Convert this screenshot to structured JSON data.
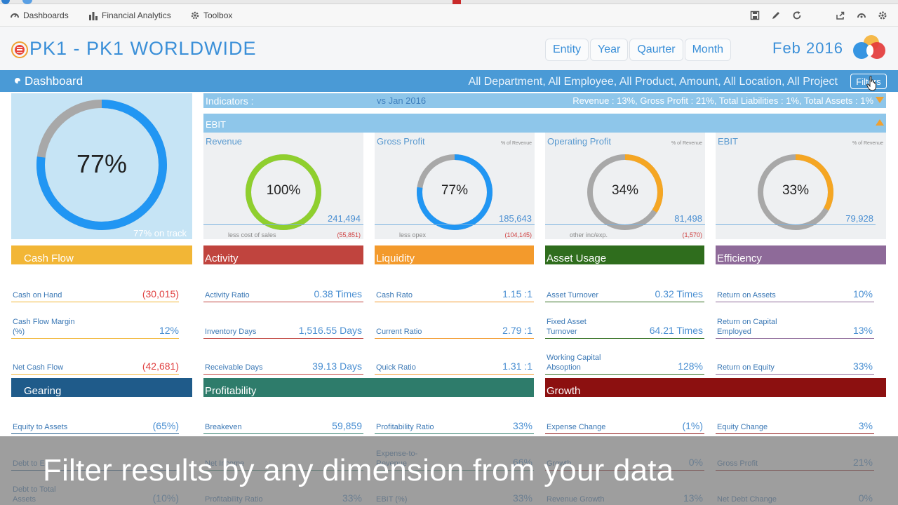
{
  "menu": {
    "dashboards": "Dashboards",
    "financial_analytics": "Financial Analytics",
    "toolbox": "Toolbox"
  },
  "header": {
    "title": "PK1 - PK1 WORLDWIDE",
    "period_buttons": [
      "Entity",
      "Year",
      "Qaurter",
      "Month"
    ],
    "current_period": "Feb 2016"
  },
  "dashboard_bar": {
    "title": "Dashboard",
    "filter_summary": "All Department, All Employee, All Product, Amount, All Location, All Project",
    "filters_label": "Filters"
  },
  "main_gauge": {
    "value": "77%",
    "fraction": 0.77,
    "caption": "77% on track"
  },
  "indicators": {
    "label": "Indicators :",
    "comparison": "vs Jan 2016",
    "summary": "Revenue : 13%, Gross Profit : 21%, Total Liabilities : 1%, Total Assets : 1%",
    "ebit_label": "EBIT"
  },
  "kpis": [
    {
      "title": "Revenue",
      "subtitle": "",
      "pct": "100%",
      "fraction": 1.0,
      "amount": "241,494",
      "note": "less cost of sales",
      "note_value": "(55,851)",
      "color": "#8fcf2e"
    },
    {
      "title": "Gross Profit",
      "subtitle": "% of Revenue",
      "pct": "77%",
      "fraction": 0.77,
      "amount": "185,643",
      "note": "less opex",
      "note_value": "(104,145)",
      "color": "#2196f3"
    },
    {
      "title": "Operating Profit",
      "subtitle": "% of Revenue",
      "pct": "34%",
      "fraction": 0.34,
      "amount": "81,498",
      "note": "other inc/exp.",
      "note_value": "(1,570)",
      "color": "#f5a623"
    },
    {
      "title": "EBIT",
      "subtitle": "% of Revenue",
      "pct": "33%",
      "fraction": 0.33,
      "amount": "79,928",
      "note": "",
      "note_value": "",
      "color": "#f5a623"
    }
  ],
  "sections": {
    "cash_flow": "Cash Flow",
    "activity": "Activity",
    "liquidity": "Liquidity",
    "asset_usage": "Asset Usage",
    "efficiency": "Efficiency",
    "gearing": "Gearing",
    "profitability": "Profitability",
    "growth": "Growth"
  },
  "colors": {
    "cash_flow": "#f2b636",
    "activity": "#c0443e",
    "liquidity": "#f39a2c",
    "asset_usage": "#2f6d1d",
    "efficiency": "#8e6a99",
    "gearing": "#1f5b8a",
    "profitability": "#2e7c6b",
    "growth": "#8c1010"
  },
  "metrics": {
    "cash_flow": [
      {
        "label": "Cash on Hand",
        "value": "(30,015)"
      },
      {
        "label": "Cash Flow Margin\n(%)",
        "value": "12%"
      },
      {
        "label": "Net Cash Flow",
        "value": "(42,681)"
      }
    ],
    "activity": [
      {
        "label": "Activity Ratio",
        "value": "0.38 Times"
      },
      {
        "label": "Inventory Days",
        "value": "1,516.55 Days"
      },
      {
        "label": "Receivable Days",
        "value": "39.13 Days"
      }
    ],
    "liquidity": [
      {
        "label": "Cash Rato",
        "value": "1.15 :1"
      },
      {
        "label": "Current Ratio",
        "value": "2.79 :1"
      },
      {
        "label": "Quick Ratio",
        "value": "1.31 :1"
      }
    ],
    "asset_usage": [
      {
        "label": "Asset Turnover",
        "value": "0.32 Times"
      },
      {
        "label": "Fixed Asset\nTurnover",
        "value": "64.21 Times"
      },
      {
        "label": "Working Capital\nAbsoption",
        "value": "128%"
      }
    ],
    "efficiency": [
      {
        "label": "Return on Assets",
        "value": "10%"
      },
      {
        "label": "Return on Capital\nEmployed",
        "value": "13%"
      },
      {
        "label": "Return on Equity",
        "value": "33%"
      }
    ],
    "gearing": [
      {
        "label": "Equity to Assets",
        "value": "(65%)"
      },
      {
        "label": "Debt to Eq",
        "value": ""
      },
      {
        "label": "Debt to Total\nAssets",
        "value": "(10%)"
      }
    ],
    "profitability_a": [
      {
        "label": "Breakeven",
        "value": "59,859"
      },
      {
        "label": "Net Income",
        "value": ""
      },
      {
        "label": "Profitability Ratio",
        "value": "33%"
      }
    ],
    "profitability_b": [
      {
        "label": "Profitability Ratio",
        "value": "33%"
      },
      {
        "label": "Expense-to-\nRevenue",
        "value": "66%"
      },
      {
        "label": "EBIT (%)",
        "value": "33%"
      }
    ],
    "growth_a": [
      {
        "label": "Expense Change",
        "value": "(1%)"
      },
      {
        "label": "Growth",
        "value": "0%"
      },
      {
        "label": "Revenue Growth",
        "value": "13%"
      }
    ],
    "growth_b": [
      {
        "label": "Equity Change",
        "value": "3%"
      },
      {
        "label": "Gross Profit",
        "value": "21%"
      },
      {
        "label": "Net Debt Change",
        "value": "0%"
      }
    ]
  },
  "caption": "Filter results by any dimension from your data"
}
